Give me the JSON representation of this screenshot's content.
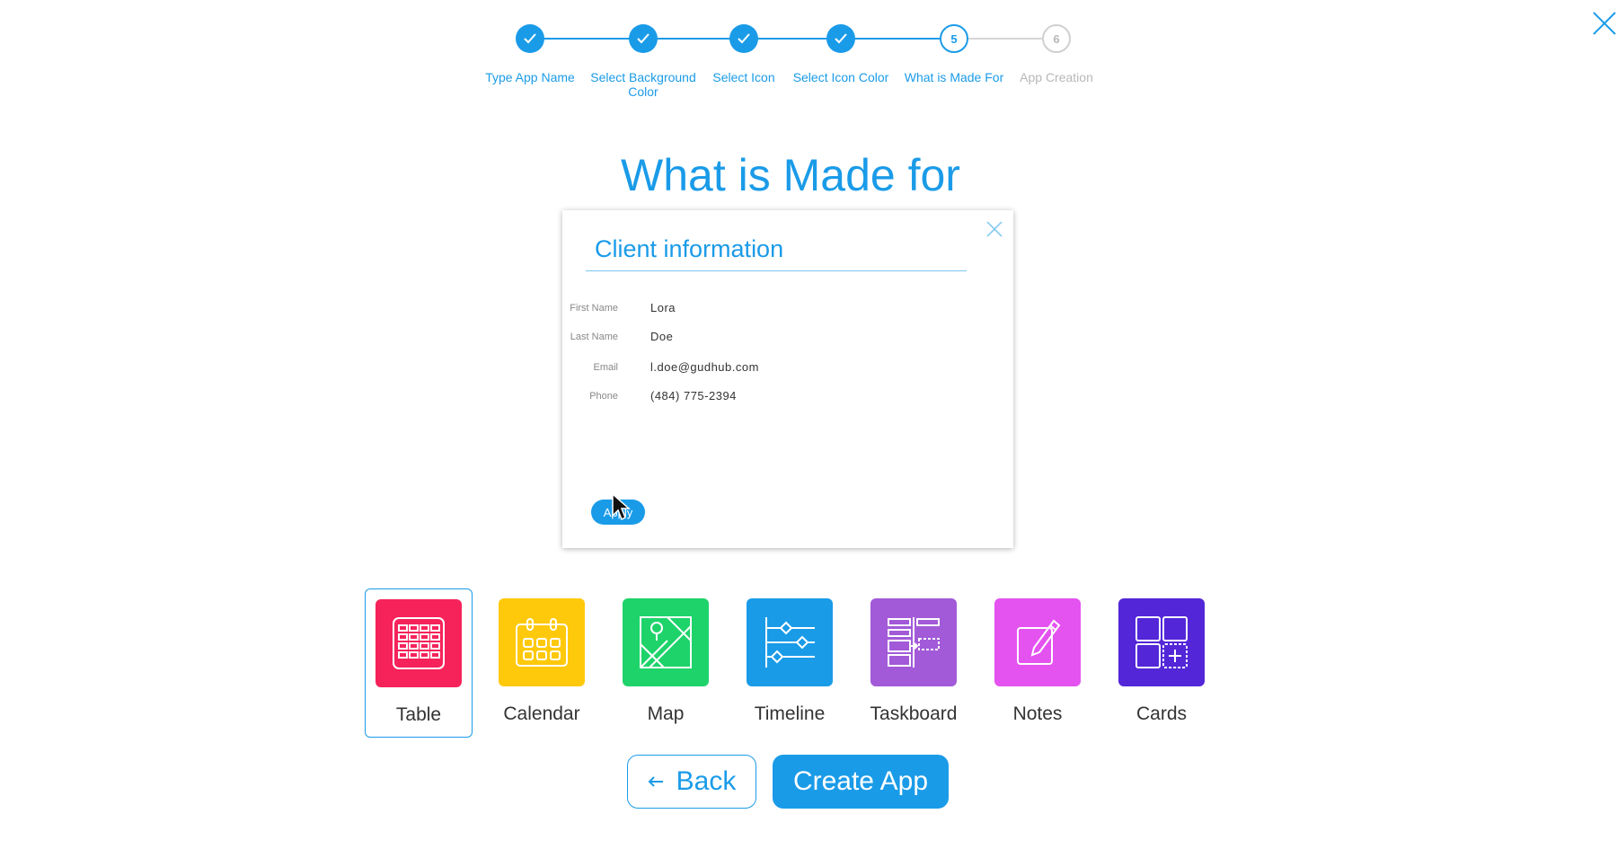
{
  "stepper": {
    "steps": [
      {
        "label": "Type App Name",
        "state": "done"
      },
      {
        "label": "Select Background Color",
        "state": "done"
      },
      {
        "label": "Select Icon",
        "state": "done"
      },
      {
        "label": "Select Icon Color",
        "state": "done"
      },
      {
        "label": "What is Made For",
        "state": "current",
        "number": "5"
      },
      {
        "label": "App Creation",
        "state": "pending",
        "number": "6"
      }
    ]
  },
  "page": {
    "title": "What is Made for"
  },
  "preview": {
    "title": "Client information",
    "fields": [
      {
        "label": "First Name",
        "value": "Lora"
      },
      {
        "label": "Last Name",
        "value": "Doe"
      },
      {
        "label": "Email",
        "value": "l.doe@gudhub.com"
      },
      {
        "label": "Phone",
        "value": "(484) 775-2394"
      }
    ],
    "apply_label": "Apply"
  },
  "tiles": [
    {
      "label": "Table",
      "icon": "table-icon",
      "color": "#f5235a",
      "selected": true
    },
    {
      "label": "Calendar",
      "icon": "calendar-icon",
      "color": "#ffc90b",
      "selected": false
    },
    {
      "label": "Map",
      "icon": "map-icon",
      "color": "#1ed36a",
      "selected": false
    },
    {
      "label": "Timeline",
      "icon": "timeline-icon",
      "color": "#1a9be8",
      "selected": false
    },
    {
      "label": "Taskboard",
      "icon": "taskboard-icon",
      "color": "#a25ad8",
      "selected": false
    },
    {
      "label": "Notes",
      "icon": "notes-icon",
      "color": "#e452f0",
      "selected": false
    },
    {
      "label": "Cards",
      "icon": "cards-icon",
      "color": "#5326d8",
      "selected": false
    }
  ],
  "buttons": {
    "back": "Back",
    "create": "Create App"
  },
  "colors": {
    "accent": "#1a9be8"
  }
}
